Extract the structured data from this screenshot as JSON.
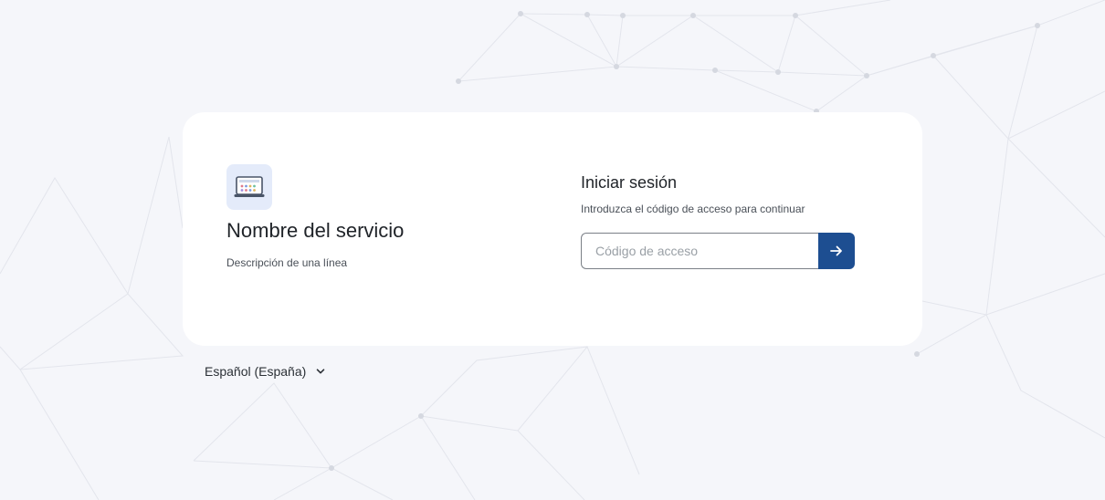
{
  "service": {
    "logo_icon": "laptop-app-icon",
    "name": "Nombre del servicio",
    "description": "Descripción de una línea"
  },
  "login": {
    "title": "Iniciar sesión",
    "subtitle": "Introduzca el código de acceso para continuar",
    "code_input": {
      "placeholder": "Código de acceso",
      "value": ""
    },
    "submit_icon": "arrow-right-icon"
  },
  "language": {
    "selected": "Español (España)",
    "icon": "chevron-down-icon"
  },
  "colors": {
    "background": "#f5f6fa",
    "card": "#ffffff",
    "accent": "#1d4e91",
    "logo_tile": "#e4ebfa"
  }
}
